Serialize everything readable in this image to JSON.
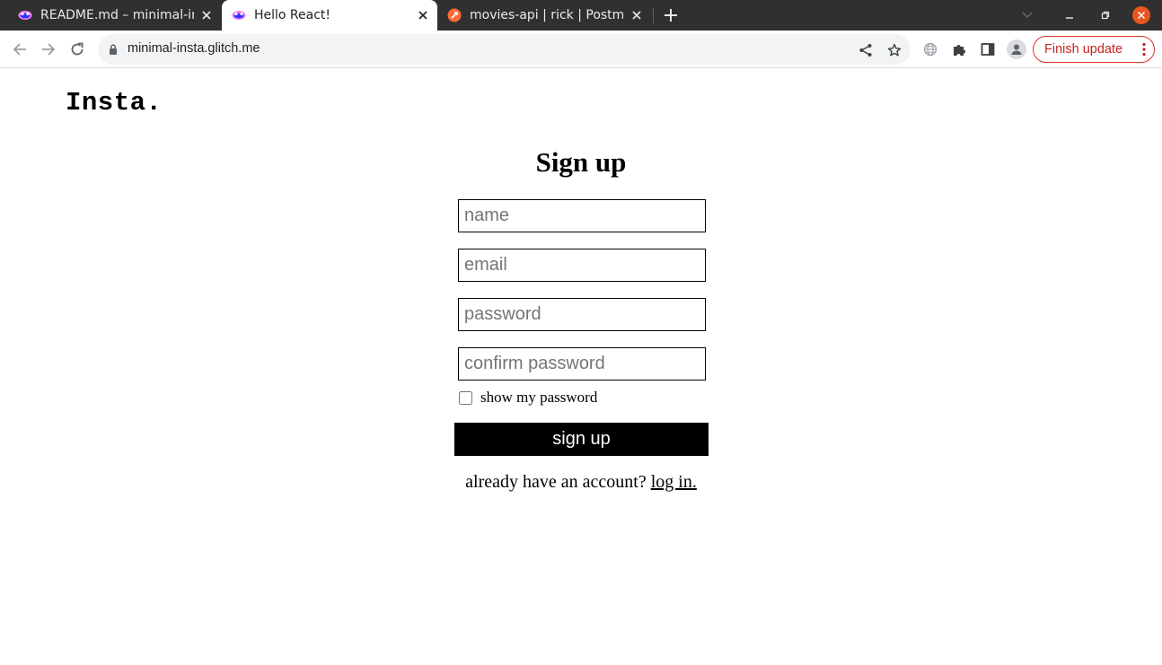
{
  "browser": {
    "tabs": [
      {
        "title": "README.md – minimal-insta",
        "icon": "glitch-icon",
        "active": false
      },
      {
        "title": "Hello React!",
        "icon": "glitch-icon",
        "active": true
      },
      {
        "title": "movies-api | rick | Postman",
        "icon": "postman-icon",
        "active": false
      }
    ],
    "url": "minimal-insta.glitch.me",
    "finish_update_label": "Finish update",
    "colors": {
      "tabstrip": "#303030",
      "close_window": "#e95420",
      "update_red": "#d93025"
    }
  },
  "page": {
    "logo": "Insta.",
    "title": "Sign up",
    "fields": {
      "name_placeholder": "name",
      "email_placeholder": "email",
      "password_placeholder": "password",
      "confirm_placeholder": "confirm password"
    },
    "show_password_label": "show my password",
    "show_password_checked": false,
    "submit_label": "sign up",
    "login_prompt": "already have an account?",
    "login_link": "log in."
  }
}
